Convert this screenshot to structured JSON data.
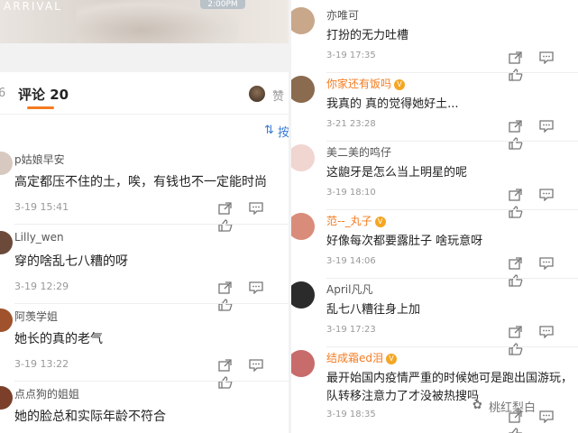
{
  "left_panel": {
    "photo": {
      "arrival_text": "ARRIVAL",
      "time_tag": "2:00PM"
    },
    "tabs": {
      "prev_count": "6",
      "comments_label": "评论",
      "comments_count": "20",
      "likes_label": "赞"
    },
    "sort_label": "按",
    "comments": [
      {
        "name": "p姑娘早安",
        "text": "高定都压不住的土，唉，有钱也不一定能时尚",
        "date": "3-19 15:41",
        "avatar_color": "#d8c9c0"
      },
      {
        "name": "Lilly_wen",
        "text": "穿的啥乱七八糟的呀",
        "date": "3-19 12:29",
        "avatar_color": "#6b4a3a"
      },
      {
        "name": "阿羡学姐",
        "text": "她长的真的老气",
        "date": "3-19 13:22",
        "avatar_color": "#a0522d"
      },
      {
        "name": "点点狗的姐姐",
        "text": "她的脸总和实际年龄不符合",
        "date": "",
        "avatar_color": "#7b3f2a"
      }
    ]
  },
  "right_panel": {
    "comments": [
      {
        "name": "亦唯可",
        "vip": false,
        "text": "打扮的无力吐槽",
        "text2": "",
        "date": "3-19 17:35",
        "avatar_color": "#c9a78a"
      },
      {
        "name": "你家还有饭吗",
        "vip": true,
        "text": "我真的 真的觉得她好土...",
        "text2": "",
        "date": "3-21 23:28",
        "avatar_color": "#8a6b4f"
      },
      {
        "name": "美二美的鸣仔",
        "vip": false,
        "text": "这龅牙是怎么当上明星的呢",
        "text2": "",
        "date": "3-19 18:10",
        "avatar_color": "#f0d5d0"
      },
      {
        "name": "范--_丸子",
        "vip": true,
        "text": "好像每次都要露肚子 啥玩意呀",
        "text2": "",
        "date": "3-19 14:06",
        "avatar_color": "#d98c7a"
      },
      {
        "name": "April凡凡",
        "vip": false,
        "text": "乱七八糟往身上加",
        "text2": "",
        "date": "3-19 17:23",
        "avatar_color": "#2b2b2b"
      },
      {
        "name": "结成霜ed泪",
        "vip": true,
        "text": "最开始国内疫情严重的时候她可是跑出国游玩，",
        "text2": "队转移注意力了才没被热搜吗",
        "date": "3-19 18:35",
        "avatar_color": "#c86b6b"
      }
    ]
  },
  "watermark": "桃红梨白",
  "colors": {
    "accent": "#f57b20",
    "link": "#3a7bd5",
    "vip_badge": "#f5a623"
  }
}
